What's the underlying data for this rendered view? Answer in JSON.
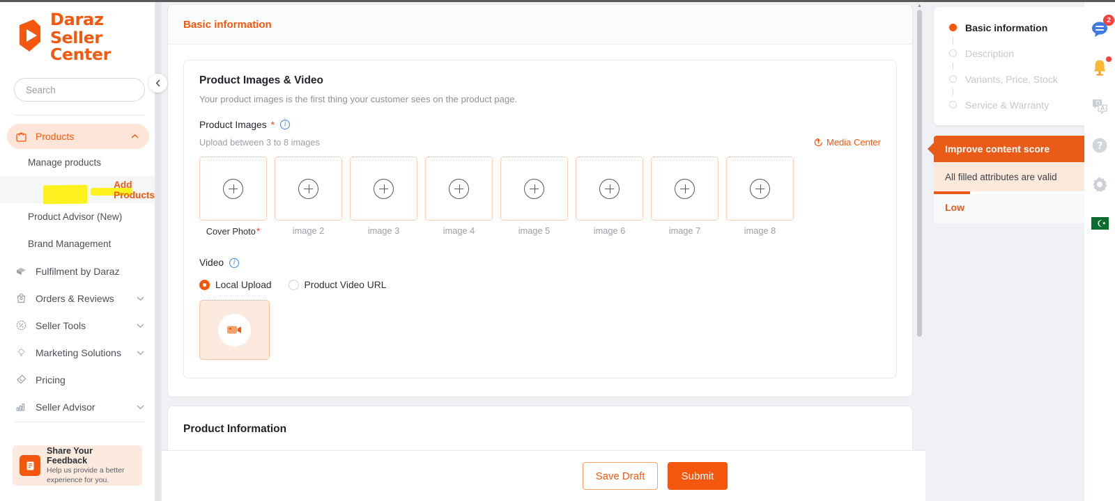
{
  "brand": {
    "name_line1": "Daraz",
    "name_line2": "Seller Center",
    "accent": "#f5570f"
  },
  "search": {
    "placeholder": "Search",
    "value": "",
    "icon": "search-icon"
  },
  "sidebar": {
    "items": [
      {
        "label": "Products",
        "icon": "bag-icon",
        "active": true,
        "expanded": true,
        "chevron": "chevron-up-icon"
      },
      {
        "label": "Fulfilment by Daraz",
        "icon": "truck-icon",
        "active": false,
        "chevron": ""
      },
      {
        "label": "Orders & Reviews",
        "icon": "order-bag-icon",
        "active": false,
        "chevron": "chevron-down-icon"
      },
      {
        "label": "Seller Tools",
        "icon": "percent-badge-icon",
        "active": false,
        "chevron": "chevron-down-icon"
      },
      {
        "label": "Marketing Solutions",
        "icon": "bulb-icon",
        "active": false,
        "chevron": "chevron-down-icon"
      },
      {
        "label": "Pricing",
        "icon": "price-tag-icon",
        "active": false,
        "chevron": ""
      },
      {
        "label": "Seller Advisor",
        "icon": "bar-chart-icon",
        "active": false,
        "chevron": "chevron-down-icon"
      }
    ],
    "subitems": [
      {
        "label": "Manage products",
        "current": false
      },
      {
        "label": "Add Products",
        "current": true,
        "highlighted": true
      },
      {
        "label": "Product Advisor (New)",
        "current": false
      },
      {
        "label": "Brand Management",
        "current": false
      }
    ],
    "feedback": {
      "title": "Share Your Feedback",
      "subtitle_line1": "Help us provide a better",
      "subtitle_line2": "experience for you.",
      "icon": "feedback-note-icon"
    },
    "collapse_icon": "chevron-left-icon"
  },
  "main": {
    "card_title": "Basic information",
    "section": {
      "title": "Product Images & Video",
      "subtitle": "Your product images is the first thing your customer sees on the product page.",
      "images_label": "Product Images",
      "required_marker": "*",
      "info_icon": "info-icon",
      "upload_hint": "Upload between 3 to 8 images",
      "media_center_label": "Media Center",
      "media_center_icon": "upload-icon",
      "slots": [
        {
          "caption": "Cover Photo",
          "required": true,
          "icon": "plus-circle-icon"
        },
        {
          "caption": "image 2",
          "required": false,
          "icon": "plus-circle-icon"
        },
        {
          "caption": "image 3",
          "required": false,
          "icon": "plus-circle-icon"
        },
        {
          "caption": "image 4",
          "required": false,
          "icon": "plus-circle-icon"
        },
        {
          "caption": "image 5",
          "required": false,
          "icon": "plus-circle-icon"
        },
        {
          "caption": "image 6",
          "required": false,
          "icon": "plus-circle-icon"
        },
        {
          "caption": "image 7",
          "required": false,
          "icon": "plus-circle-icon"
        },
        {
          "caption": "image 8",
          "required": false,
          "icon": "plus-circle-icon"
        }
      ],
      "video_label": "Video",
      "video_options": [
        {
          "label": "Local Upload",
          "selected": true
        },
        {
          "label": "Product Video URL",
          "selected": false
        }
      ],
      "video_upload_icon": "video-camera-icon"
    },
    "next_section_title": "Product Information",
    "actions": {
      "save_draft": "Save Draft",
      "submit": "Submit"
    }
  },
  "right": {
    "steps": [
      {
        "label": "Basic information",
        "state": "active"
      },
      {
        "label": "Description",
        "state": "pending"
      },
      {
        "label": "Variants, Price, Stock",
        "state": "pending"
      },
      {
        "label": "Service & Warranty",
        "state": "pending"
      }
    ],
    "score": {
      "header": "Improve content score",
      "message": "All filled attributes are valid",
      "progress_percent": 22,
      "level": "Low",
      "accent": "#ea5b17"
    }
  },
  "rail": {
    "items": [
      {
        "icon": "chat-message-icon",
        "badge": "2"
      },
      {
        "icon": "bell-icon",
        "dot": true
      },
      {
        "icon": "qa-icon"
      },
      {
        "icon": "help-circle-icon"
      },
      {
        "icon": "gear-icon"
      },
      {
        "icon": "pakistan-flag-icon"
      }
    ]
  }
}
